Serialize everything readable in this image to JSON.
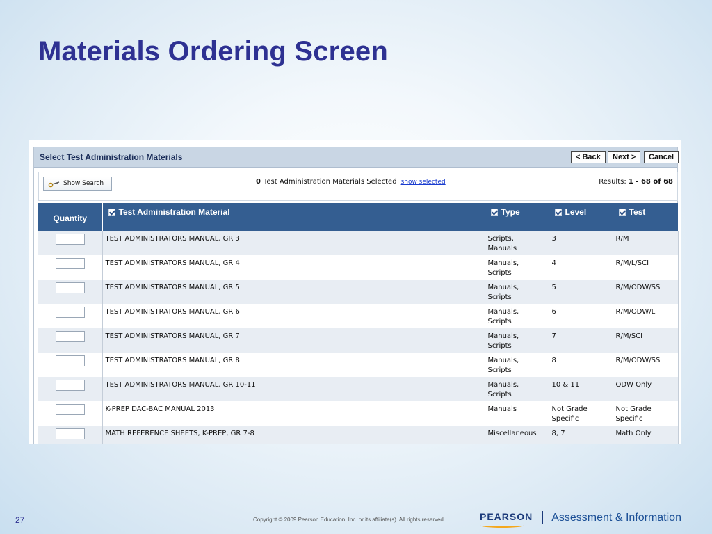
{
  "slide": {
    "title": "Materials Ordering Screen",
    "number": "27",
    "copyright": "Copyright © 2009 Pearson Education, Inc. or its affiliate(s). All rights reserved.",
    "brand": "PEARSON",
    "brand_tagline": "Assessment & Information"
  },
  "app": {
    "header_title": "Select Test Administration Materials",
    "buttons": {
      "back": "< Back",
      "next": "Next >",
      "cancel": "Cancel"
    },
    "show_search": "Show Search",
    "selected_count": "0",
    "selected_text": "Test Administration Materials Selected",
    "show_selected": "show selected",
    "results_label": "Results:",
    "results_range": "1 - 68 of 68"
  },
  "table": {
    "columns": {
      "quantity": "Quantity",
      "material": "Test Administration Material",
      "type": "Type",
      "level": "Level",
      "test": "Test"
    },
    "rows": [
      {
        "material": "TEST ADMINISTRATORS MANUAL, GR 3",
        "type": [
          "Scripts,",
          "Manuals"
        ],
        "level": [
          "3"
        ],
        "test": [
          "R/M"
        ]
      },
      {
        "material": "TEST ADMINISTRATORS MANUAL, GR 4",
        "type": [
          "Manuals,",
          "Scripts"
        ],
        "level": [
          "4"
        ],
        "test": [
          "R/M/L/SCI"
        ]
      },
      {
        "material": "TEST ADMINISTRATORS MANUAL, GR 5",
        "type": [
          "Manuals,",
          "Scripts"
        ],
        "level": [
          "5"
        ],
        "test": [
          "R/M/ODW/SS"
        ]
      },
      {
        "material": "TEST ADMINISTRATORS MANUAL, GR 6",
        "type": [
          "Manuals,",
          "Scripts"
        ],
        "level": [
          "6"
        ],
        "test": [
          "R/M/ODW/L"
        ]
      },
      {
        "material": "TEST ADMINISTRATORS MANUAL, GR 7",
        "type": [
          "Manuals,",
          "Scripts"
        ],
        "level": [
          "7"
        ],
        "test": [
          "R/M/SCI"
        ]
      },
      {
        "material": "TEST ADMINISTRATORS MANUAL, GR 8",
        "type": [
          "Manuals,",
          "Scripts"
        ],
        "level": [
          "8"
        ],
        "test": [
          "R/M/ODW/SS"
        ]
      },
      {
        "material": "TEST ADMINISTRATORS MANUAL, GR 10-11",
        "type": [
          "Manuals,",
          "Scripts"
        ],
        "level": [
          "10 & 11"
        ],
        "test": [
          "ODW Only"
        ]
      },
      {
        "material": "K-PREP DAC-BAC MANUAL 2013",
        "type": [
          "Manuals"
        ],
        "level": [
          "Not Grade",
          "Specific"
        ],
        "test": [
          "Not Grade",
          "Specific"
        ]
      },
      {
        "material": "MATH REFERENCE SHEETS, K-PREP, GR 7-8",
        "type": [
          "Miscellaneous"
        ],
        "level": [
          "8, 7"
        ],
        "test": [
          "Math Only"
        ]
      }
    ]
  },
  "colors": {
    "title": "#2e3192",
    "header_bar": "#c9d6e4",
    "table_header": "#345e91",
    "row_alt": "#e8edf3",
    "brand_orange": "#f4a81d"
  }
}
